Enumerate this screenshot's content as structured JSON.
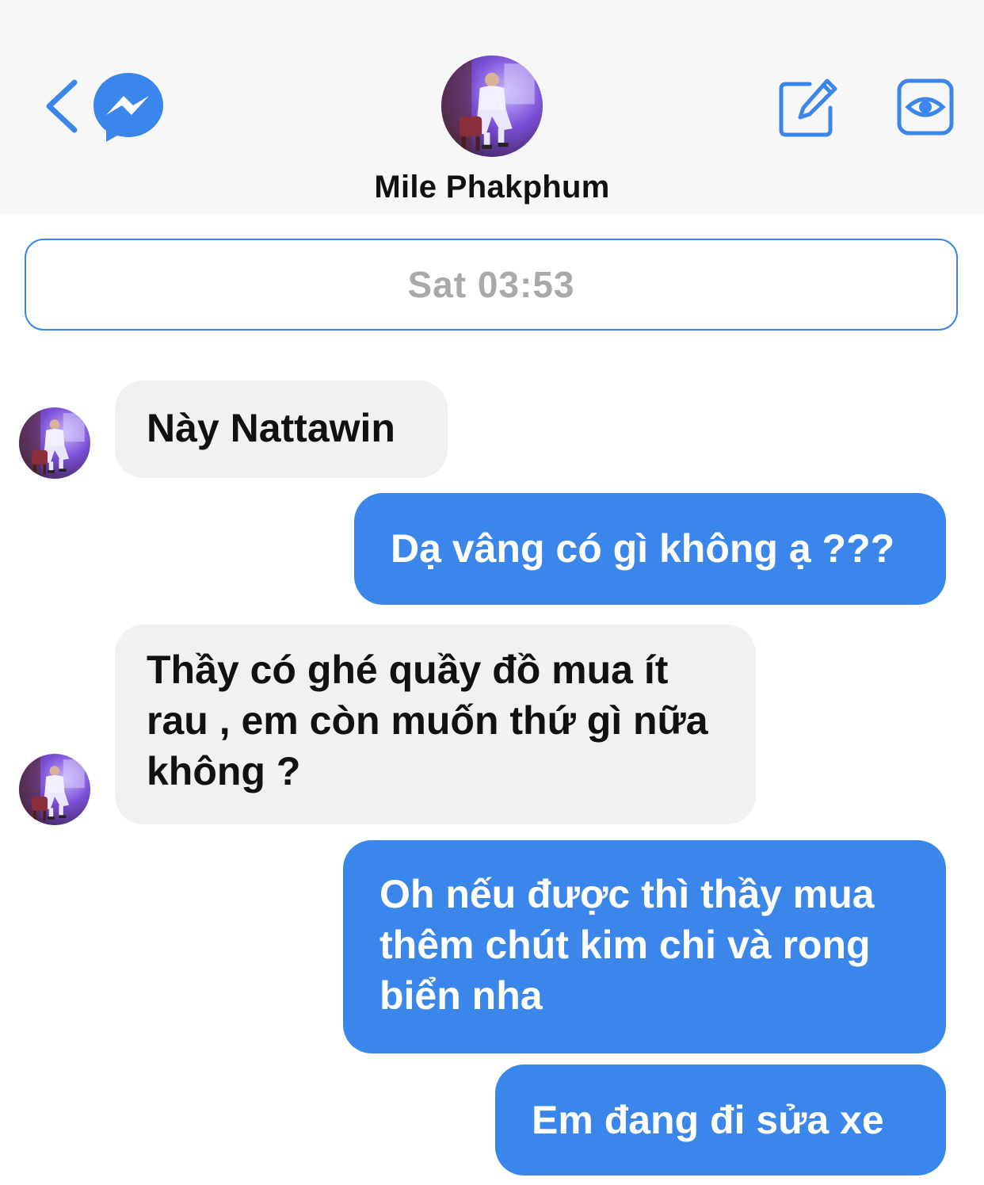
{
  "header": {
    "contact_name": "Mile Phakphum",
    "back_icon": "chevron-left-icon",
    "app_icon": "messenger-icon",
    "compose_icon": "compose-icon",
    "view_icon": "eye-icon",
    "accent_color": "#3b86ea"
  },
  "conversation": {
    "timestamp": "Sat 03:53",
    "messages": [
      {
        "direction": "incoming",
        "text": "Này Nattawin"
      },
      {
        "direction": "outgoing",
        "text": "Dạ vâng có gì không ạ ???"
      },
      {
        "direction": "incoming",
        "text": "Thầy có ghé quầy đồ mua ít rau , em còn muốn thứ gì nữa không ?"
      },
      {
        "direction": "outgoing",
        "text": "Oh nếu được thì thầy mua thêm chút kim chi và rong biển nha"
      },
      {
        "direction": "outgoing",
        "text": "Em đang đi sửa xe"
      }
    ]
  },
  "colors": {
    "incoming_bubble": "#f1f1f1",
    "outgoing_bubble": "#3b86ea",
    "header_bg": "#f7f7f7",
    "timestamp_text": "#a9a9a9"
  }
}
